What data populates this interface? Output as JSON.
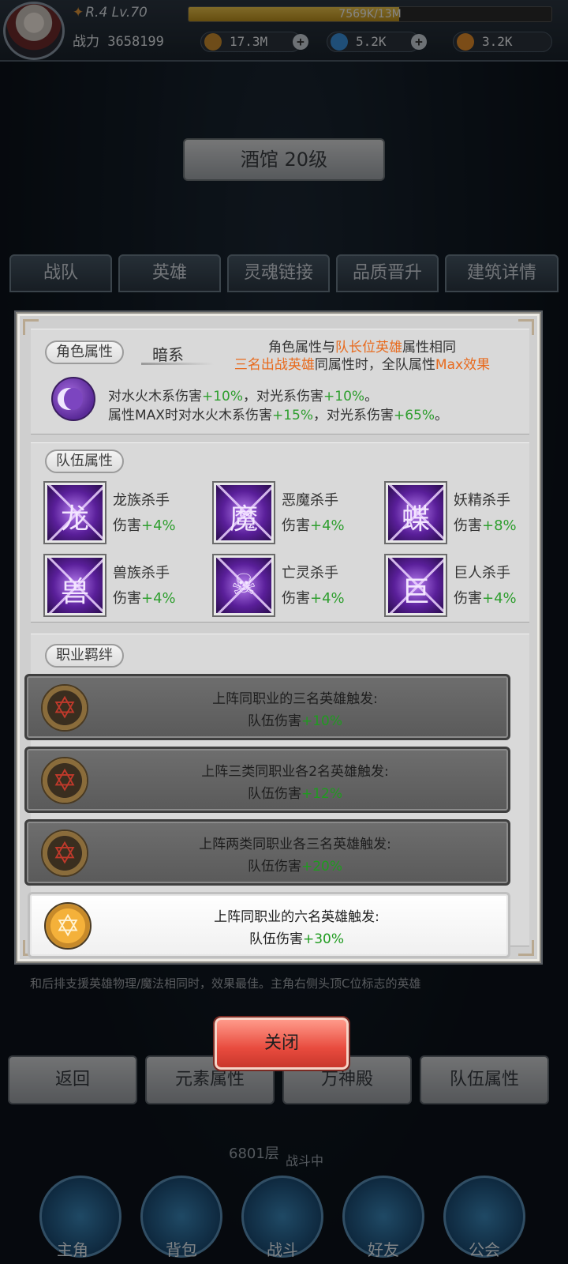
{
  "hud": {
    "rank_level": "R.4 Lv.70",
    "exp_text": "7569K/13M",
    "exp_fraction": 0.58,
    "power_label": "战力 3658199",
    "resources": [
      {
        "icon": "gold-coin-icon",
        "value": "17.3M",
        "color": "#c98b2e"
      },
      {
        "icon": "blue-gem-icon",
        "value": "5.2K",
        "color": "#3a8fd9"
      },
      {
        "icon": "orange-gem-icon",
        "value": "3.2K",
        "color": "#e08a2a"
      }
    ]
  },
  "page": {
    "title": "酒馆 20级",
    "tabs": [
      "战队",
      "英雄",
      "灵魂链接",
      "品质晋升",
      "建筑详情"
    ],
    "bottom_buttons": [
      "返回",
      "元素属性",
      "万神殿",
      "队伍属性"
    ],
    "behind_text": "和后排支援英雄物理/魔法相同时，效果最佳。主角右侧头顶C位标志的英雄",
    "floor": "6801层",
    "battle": "战斗中",
    "nav": [
      "主角",
      "背包",
      "战斗",
      "好友",
      "公会"
    ]
  },
  "modal": {
    "role_attr": {
      "tag": "角色属性",
      "element": "暗系",
      "rule_line1_a": "角色属性与",
      "rule_line1_b": "队长位英雄",
      "rule_line1_c": "属性相同",
      "rule_line2_a": "三名出战英雄",
      "rule_line2_b": "同属性时，全队属性",
      "rule_line2_c": "Max效果",
      "effect1_a": "对水火木系伤害",
      "effect1_b": "+10%",
      "effect1_c": "，对光系伤害",
      "effect1_d": "+10%",
      "effect1_e": "。",
      "effect2_a": "属性MAX时对水火木系伤害",
      "effect2_b": "+15%",
      "effect2_c": "，对光系伤害",
      "effect2_d": "+65%",
      "effect2_e": "。"
    },
    "team_attr": {
      "tag": "队伍属性",
      "traits": [
        {
          "name": "龙族杀手",
          "label": "伤害",
          "value": "+4%",
          "icon": "dragon-icon"
        },
        {
          "name": "恶魔杀手",
          "label": "伤害",
          "value": "+4%",
          "icon": "demon-icon"
        },
        {
          "name": "妖精杀手",
          "label": "伤害",
          "value": "+8%",
          "icon": "fairy-icon"
        },
        {
          "name": "兽族杀手",
          "label": "伤害",
          "value": "+4%",
          "icon": "beast-icon"
        },
        {
          "name": "亡灵杀手",
          "label": "伤害",
          "value": "+4%",
          "icon": "skull-icon"
        },
        {
          "name": "巨人杀手",
          "label": "伤害",
          "value": "+4%",
          "icon": "giant-icon"
        }
      ]
    },
    "class_bond": {
      "tag": "职业羁绊",
      "bonds": [
        {
          "line1": "上阵同职业的三名英雄触发:",
          "prefix": "队伍伤害",
          "value": "+10%",
          "active": false
        },
        {
          "line1": "上阵三类同职业各2名英雄触发:",
          "prefix": "队伍伤害",
          "value": "+12%",
          "active": false
        },
        {
          "line1": "上阵两类同职业各三名英雄触发:",
          "prefix": "队伍伤害",
          "value": "+20%",
          "active": false
        },
        {
          "line1": "上阵同职业的六名英雄触发:",
          "prefix": "队伍伤害",
          "value": "+30%",
          "active": true
        }
      ]
    },
    "close_label": "关闭"
  }
}
